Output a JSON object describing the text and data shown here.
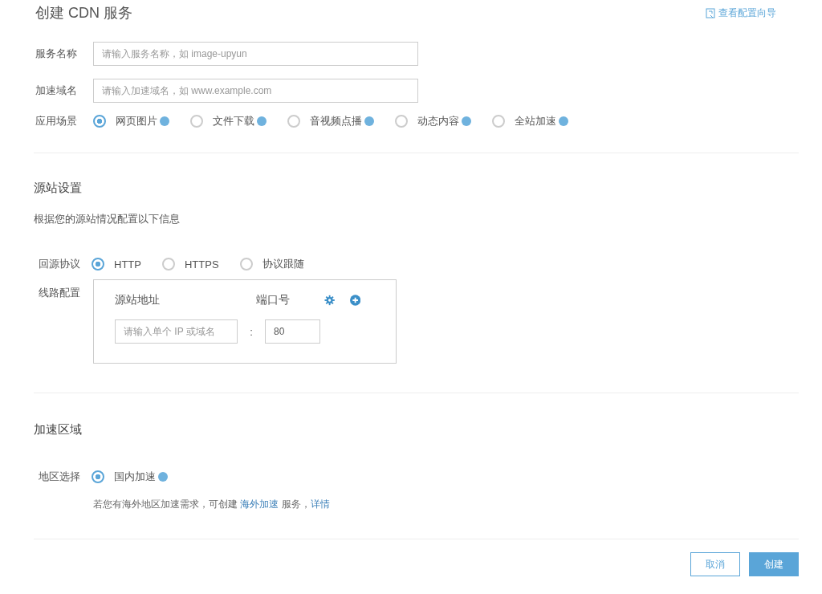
{
  "title": "创建 CDN 服务",
  "guide_link": "查看配置向导",
  "basic": {
    "fields": [
      {
        "label": "服务名称",
        "placeholder": "请输入服务名称，如 image-upyun"
      },
      {
        "label": "加速域名",
        "placeholder": "请输入加速域名，如 www.example.com"
      }
    ],
    "scenario": {
      "label": "应用场景",
      "options": [
        {
          "label": "网页图片",
          "selected": true,
          "help": true
        },
        {
          "label": "文件下载",
          "selected": false,
          "help": true
        },
        {
          "label": "音视频点播",
          "selected": false,
          "help": true
        },
        {
          "label": "动态内容",
          "selected": false,
          "help": true
        },
        {
          "label": "全站加速",
          "selected": false,
          "help": true
        }
      ]
    }
  },
  "origin": {
    "heading": "源站设置",
    "description": "根据您的源站情况配置以下信息",
    "protocol": {
      "label": "回源协议",
      "options": [
        {
          "label": "HTTP",
          "selected": true
        },
        {
          "label": "HTTPS",
          "selected": false
        },
        {
          "label": "协议跟随",
          "selected": false
        }
      ]
    },
    "route": {
      "label": "线路配置",
      "address_header": "源站地址",
      "port_header": "端口号",
      "address_placeholder": "请输入单个 IP 或域名",
      "separator": ":",
      "port_value": "80"
    }
  },
  "region": {
    "heading": "加速区域",
    "label": "地区选择",
    "options": [
      {
        "label": "国内加速",
        "selected": true,
        "help": true
      }
    ],
    "note": {
      "before": "若您有海外地区加速需求，可创建 ",
      "link": "海外加速",
      "middle": " 服务，",
      "link2": "详情"
    }
  },
  "buttons": {
    "cancel": "取消",
    "create": "创建"
  }
}
